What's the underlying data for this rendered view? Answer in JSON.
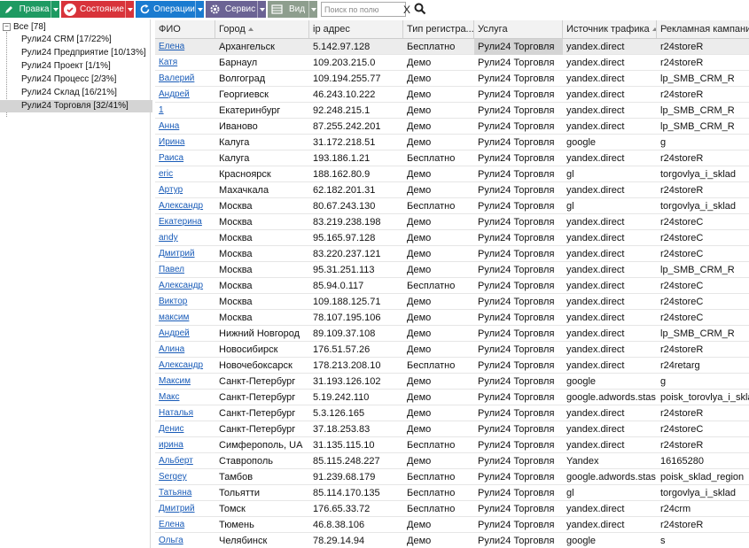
{
  "toolbar": {
    "buttons": [
      {
        "label": "Правка",
        "color": "#1e9a62",
        "icon": "pencil-icon"
      },
      {
        "label": "Состояние",
        "color": "#d8333a",
        "icon": "check-icon"
      },
      {
        "label": "Операции",
        "color": "#1a7bd0",
        "icon": "refresh-icon"
      },
      {
        "label": "Сервис",
        "color": "#6b6394",
        "icon": "gear-icon"
      },
      {
        "label": "Вид",
        "color": "#8e9e8e",
        "icon": "view-icon"
      }
    ],
    "search_placeholder": "Поиск по полю",
    "clear_label": "X"
  },
  "tree": {
    "root": "Все [78]",
    "items": [
      "Рули24 CRM [17/22%]",
      "Рули24 Предприятие [10/13%]",
      "Рули24 Проект [1/1%]",
      "Рули24 Процесс [2/3%]",
      "Рули24 Склад [16/21%]",
      "Рули24 Торговля [32/41%]"
    ],
    "selected": 5
  },
  "table": {
    "columns": [
      "ФИО",
      "Город",
      "ip адрес",
      "Тип регистра...",
      "Услуга",
      "Источник трафика",
      "Рекламная кампания"
    ],
    "rows": [
      [
        "Елена",
        "Архангельск",
        "5.142.97.128",
        "Бесплатно",
        "Рули24 Торговля",
        "yandex.direct",
        "r24storeR"
      ],
      [
        "Катя",
        "Барнаул",
        "109.203.215.0",
        "Демо",
        "Рули24 Торговля",
        "yandex.direct",
        "r24storeR"
      ],
      [
        "Валерий",
        "Волгоград",
        "109.194.255.77",
        "Демо",
        "Рули24 Торговля",
        "yandex.direct",
        "lp_SMB_CRM_R"
      ],
      [
        "Андрей",
        "Георгиевск",
        "46.243.10.222",
        "Демо",
        "Рули24 Торговля",
        "yandex.direct",
        "r24storeR"
      ],
      [
        "1",
        "Екатеринбург",
        "92.248.215.1",
        "Демо",
        "Рули24 Торговля",
        "yandex.direct",
        "lp_SMB_CRM_R"
      ],
      [
        "Анна",
        "Иваново",
        "87.255.242.201",
        "Демо",
        "Рули24 Торговля",
        "yandex.direct",
        "lp_SMB_CRM_R"
      ],
      [
        "Ирина",
        "Калуга",
        "31.172.218.51",
        "Демо",
        "Рули24 Торговля",
        "google",
        "g"
      ],
      [
        "Раиса",
        "Калуга",
        "193.186.1.21",
        "Бесплатно",
        "Рули24 Торговля",
        "yandex.direct",
        "r24storeR"
      ],
      [
        "eric",
        "Красноярск",
        "188.162.80.9",
        "Демо",
        "Рули24 Торговля",
        "gl",
        "torgovlya_i_sklad"
      ],
      [
        "Артур",
        "Махачкала",
        "62.182.201.31",
        "Демо",
        "Рули24 Торговля",
        "yandex.direct",
        "r24storeR"
      ],
      [
        "Александр",
        "Москва",
        "80.67.243.130",
        "Бесплатно",
        "Рули24 Торговля",
        "gl",
        "torgovlya_i_sklad"
      ],
      [
        "Екатерина",
        "Москва",
        "83.219.238.198",
        "Демо",
        "Рули24 Торговля",
        "yandex.direct",
        "r24storeC"
      ],
      [
        "andy",
        "Москва",
        "95.165.97.128",
        "Демо",
        "Рули24 Торговля",
        "yandex.direct",
        "r24storeC"
      ],
      [
        "Дмитрий",
        "Москва",
        "83.220.237.121",
        "Демо",
        "Рули24 Торговля",
        "yandex.direct",
        "r24storeC"
      ],
      [
        "Павел",
        "Москва",
        "95.31.251.113",
        "Демо",
        "Рули24 Торговля",
        "yandex.direct",
        "lp_SMB_CRM_R"
      ],
      [
        "Александр",
        "Москва",
        "85.94.0.117",
        "Бесплатно",
        "Рули24 Торговля",
        "yandex.direct",
        "r24storeC"
      ],
      [
        "Виктор",
        "Москва",
        "109.188.125.71",
        "Демо",
        "Рули24 Торговля",
        "yandex.direct",
        "r24storeC"
      ],
      [
        "максим",
        "Москва",
        "78.107.195.106",
        "Демо",
        "Рули24 Торговля",
        "yandex.direct",
        "r24storeC"
      ],
      [
        "Андрей",
        "Нижний Новгород",
        "89.109.37.108",
        "Демо",
        "Рули24 Торговля",
        "yandex.direct",
        "lp_SMB_CRM_R"
      ],
      [
        "Алина",
        "Новосибирск",
        "176.51.57.26",
        "Демо",
        "Рули24 Торговля",
        "yandex.direct",
        "r24storeR"
      ],
      [
        "Александр",
        "Новочебоксарск",
        "178.213.208.10",
        "Бесплатно",
        "Рули24 Торговля",
        "yandex.direct",
        "r24retarg"
      ],
      [
        "Максим",
        "Санкт-Петербург",
        "31.193.126.102",
        "Демо",
        "Рули24 Торговля",
        "google",
        "g"
      ],
      [
        "Макс",
        "Санкт-Петербург",
        "5.19.242.110",
        "Демо",
        "Рули24 Торговля",
        "google.adwords.stas",
        "poisk_torovlya_i_sklad"
      ],
      [
        "Наталья",
        "Санкт-Петербург",
        "5.3.126.165",
        "Демо",
        "Рули24 Торговля",
        "yandex.direct",
        "r24storeR"
      ],
      [
        "Денис",
        "Санкт-Петербург",
        "37.18.253.83",
        "Демо",
        "Рули24 Торговля",
        "yandex.direct",
        "r24storeC"
      ],
      [
        "ирина",
        "Симферополь, UA",
        "31.135.115.10",
        "Бесплатно",
        "Рули24 Торговля",
        "yandex.direct",
        "r24storeR"
      ],
      [
        "Альберт",
        "Ставрополь",
        "85.115.248.227",
        "Демо",
        "Рули24 Торговля",
        "Yandex",
        "16165280"
      ],
      [
        "Sergey",
        "Тамбов",
        "91.239.68.179",
        "Бесплатно",
        "Рули24 Торговля",
        "google.adwords.stas",
        "poisk_sklad_region"
      ],
      [
        "Татьяна",
        "Тольятти",
        "85.114.170.135",
        "Бесплатно",
        "Рули24 Торговля",
        "gl",
        "torgovlya_i_sklad"
      ],
      [
        "Дмитрий",
        "Томск",
        "176.65.33.72",
        "Бесплатно",
        "Рули24 Торговля",
        "yandex.direct",
        "r24crm"
      ],
      [
        "Елена",
        "Тюмень",
        "46.8.38.106",
        "Демо",
        "Рули24 Торговля",
        "yandex.direct",
        "r24storeR"
      ],
      [
        "Ольга",
        "Челябинск",
        "78.29.14.94",
        "Демо",
        "Рули24 Торговля",
        "google",
        "s"
      ]
    ]
  }
}
